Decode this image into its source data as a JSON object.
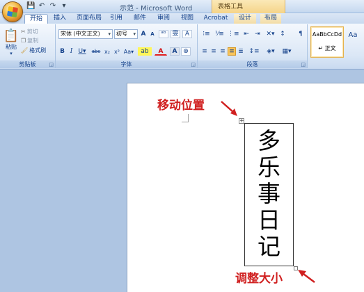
{
  "window": {
    "title": "示范 - Microsoft Word",
    "context_tab_group": "表格工具"
  },
  "quick_access": {
    "save_icon": "save-icon",
    "undo_icon": "undo-icon",
    "redo_icon": "redo-icon",
    "customize_icon": "dropdown-icon"
  },
  "tabs": [
    {
      "label": "开始",
      "active": true
    },
    {
      "label": "插入"
    },
    {
      "label": "页面布局"
    },
    {
      "label": "引用"
    },
    {
      "label": "邮件"
    },
    {
      "label": "审阅"
    },
    {
      "label": "视图"
    },
    {
      "label": "Acrobat"
    },
    {
      "label": "设计"
    },
    {
      "label": "布局"
    }
  ],
  "clipboard": {
    "group_label": "剪贴板",
    "paste_label": "粘贴",
    "cut_label": "剪切",
    "copy_label": "复制",
    "format_painter_label": "格式刷"
  },
  "font": {
    "group_label": "字体",
    "font_name": "宋体 (中文正文)",
    "font_size": "初号",
    "phonetic_label": "雯",
    "border_char": "A"
  },
  "paragraph": {
    "group_label": "段落"
  },
  "styles": {
    "sample": "AaBbCcDd",
    "name": "↵ 正文",
    "next_sample": "Aa"
  },
  "document": {
    "cell_text": [
      "多",
      "乐",
      "事",
      "日",
      "记"
    ]
  },
  "annotations": {
    "move_label": "移动位置",
    "resize_label": "调整大小",
    "color": "#d02020"
  }
}
